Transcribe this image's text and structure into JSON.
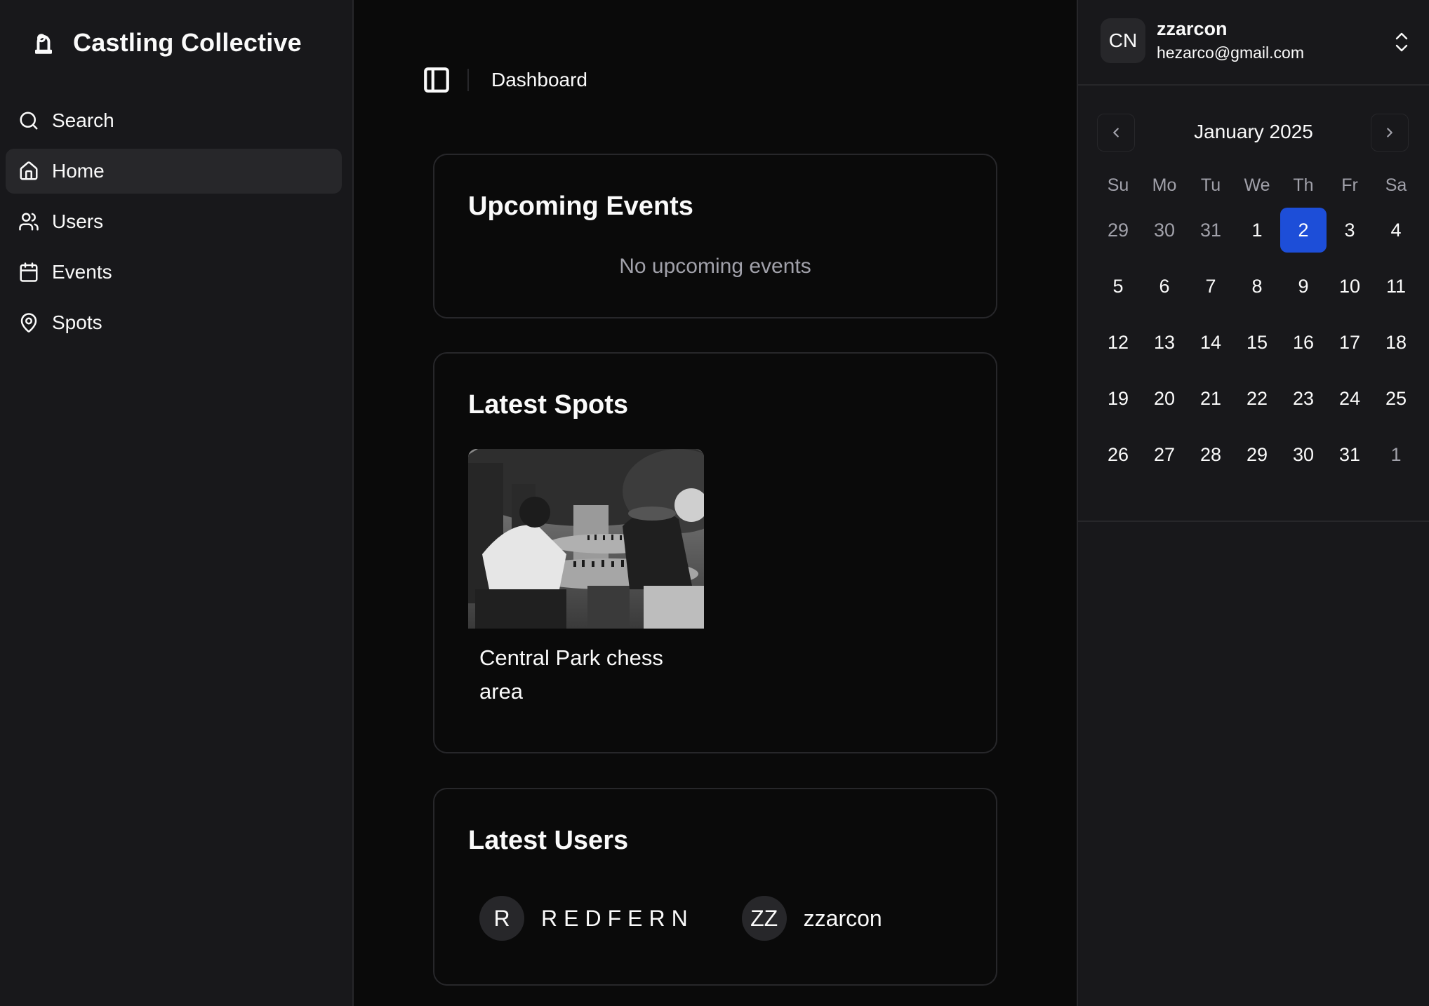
{
  "brand": {
    "name": "Castling Collective",
    "icon": "chess-rook-icon"
  },
  "sidebar": {
    "items": [
      {
        "label": "Search",
        "icon": "search-icon",
        "active": false
      },
      {
        "label": "Home",
        "icon": "home-icon",
        "active": true
      },
      {
        "label": "Users",
        "icon": "users-icon",
        "active": false
      },
      {
        "label": "Events",
        "icon": "calendar-icon",
        "active": false
      },
      {
        "label": "Spots",
        "icon": "map-pin-icon",
        "active": false
      }
    ]
  },
  "topbar": {
    "breadcrumb": "Dashboard",
    "toggle_icon": "sidebar-toggle-icon"
  },
  "events": {
    "title": "Upcoming Events",
    "empty_message": "No upcoming events"
  },
  "spots": {
    "title": "Latest Spots",
    "items": [
      {
        "name": "Central Park chess area",
        "image": "black-and-white photo of men playing chess at outdoor stone tables"
      }
    ]
  },
  "users": {
    "title": "Latest Users",
    "items": [
      {
        "initials": "R",
        "name": "REDFERN"
      },
      {
        "initials": "ZZ",
        "name": "zzarcon"
      }
    ]
  },
  "account": {
    "initials": "CN",
    "name": "zzarcon",
    "email": "hezarco@gmail.com"
  },
  "calendar": {
    "title": "January 2025",
    "weekdays": [
      "Su",
      "Mo",
      "Tu",
      "We",
      "Th",
      "Fr",
      "Sa"
    ],
    "selected_day": 2,
    "accent_color": "#1d4ed8",
    "weeks": [
      [
        {
          "d": "29",
          "out": true
        },
        {
          "d": "30",
          "out": true
        },
        {
          "d": "31",
          "out": true
        },
        {
          "d": "1"
        },
        {
          "d": "2",
          "sel": true
        },
        {
          "d": "3"
        },
        {
          "d": "4"
        }
      ],
      [
        {
          "d": "5"
        },
        {
          "d": "6"
        },
        {
          "d": "7"
        },
        {
          "d": "8"
        },
        {
          "d": "9"
        },
        {
          "d": "10"
        },
        {
          "d": "11"
        }
      ],
      [
        {
          "d": "12"
        },
        {
          "d": "13"
        },
        {
          "d": "14"
        },
        {
          "d": "15"
        },
        {
          "d": "16"
        },
        {
          "d": "17"
        },
        {
          "d": "18"
        }
      ],
      [
        {
          "d": "19"
        },
        {
          "d": "20"
        },
        {
          "d": "21"
        },
        {
          "d": "22"
        },
        {
          "d": "23"
        },
        {
          "d": "24"
        },
        {
          "d": "25"
        }
      ],
      [
        {
          "d": "26"
        },
        {
          "d": "27"
        },
        {
          "d": "28"
        },
        {
          "d": "29"
        },
        {
          "d": "30"
        },
        {
          "d": "31"
        },
        {
          "d": "1",
          "out": true
        }
      ]
    ]
  }
}
